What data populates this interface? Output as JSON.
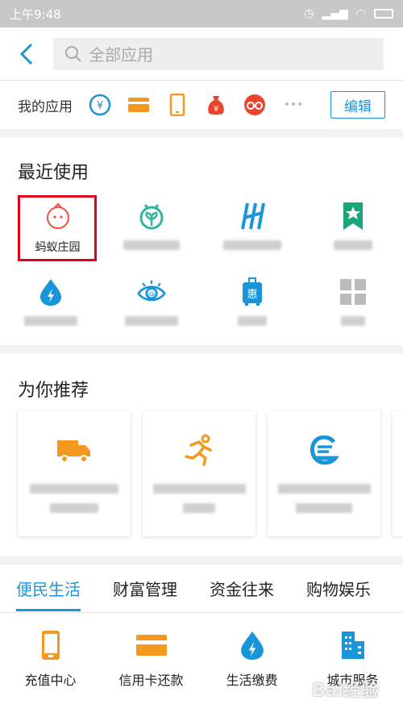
{
  "status_bar": {
    "time": "上午9:48"
  },
  "header": {
    "search_placeholder": "全部应用"
  },
  "my_apps": {
    "label": "我的应用",
    "icons": [
      "yuan-circle-icon",
      "card-icon",
      "phone-icon",
      "money-bag-icon",
      "glasses-icon",
      "more-icon"
    ],
    "more": "•••",
    "edit_label": "编辑"
  },
  "recent": {
    "title": "最近使用",
    "items": [
      {
        "label": "蚂蚁庄园",
        "icon": "chick-icon",
        "color": "#f0513a"
      },
      {
        "label": "",
        "icon": "sprout-icon",
        "color": "#2fb59d"
      },
      {
        "label": "",
        "icon": "h-logo-icon",
        "color": "#1a96d8"
      },
      {
        "label": "",
        "icon": "bookmark-star-icon",
        "color": "#1aa67a"
      },
      {
        "label": "",
        "icon": "water-drop-icon",
        "color": "#1a96d8"
      },
      {
        "label": "",
        "icon": "eye-at-icon",
        "color": "#1a96d8"
      },
      {
        "label": "",
        "icon": "luggage-icon",
        "color": "#1a96d8"
      },
      {
        "label": "",
        "icon": "grid-icon",
        "color": "#bbbbbb"
      }
    ]
  },
  "recommend": {
    "title": "为你推荐",
    "cards": [
      {
        "icon": "truck-icon",
        "color": "#f39a1e"
      },
      {
        "icon": "runner-icon",
        "color": "#f39a1e"
      },
      {
        "icon": "e-logo-icon",
        "color": "#1a96d8"
      }
    ]
  },
  "tabs": [
    "便民生活",
    "财富管理",
    "资金往来",
    "购物娱乐"
  ],
  "services": [
    {
      "label": "充值中心",
      "icon": "phone-icon",
      "color": "#f39a1e"
    },
    {
      "label": "信用卡还款",
      "icon": "card-icon",
      "color": "#f39a1e"
    },
    {
      "label": "生活缴费",
      "icon": "water-drop-icon",
      "color": "#1a96d8"
    },
    {
      "label": "城市服务",
      "icon": "building-icon",
      "color": "#1a96d8"
    }
  ],
  "watermark": "Bai经验"
}
